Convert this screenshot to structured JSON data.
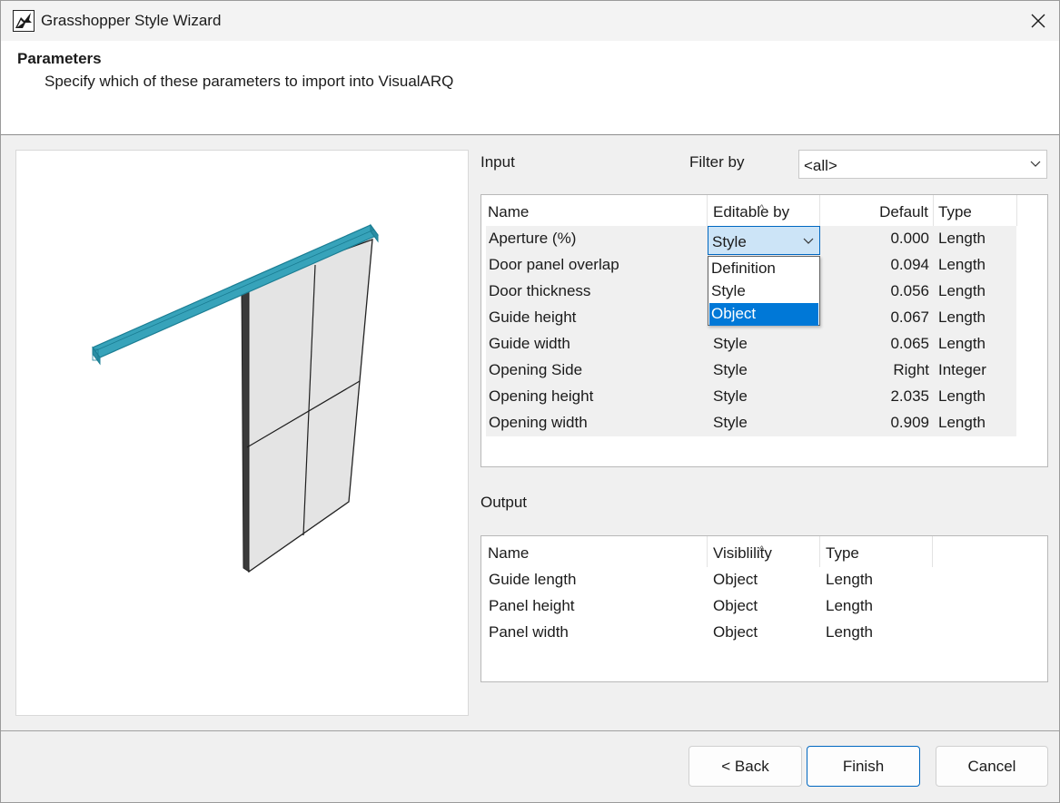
{
  "window": {
    "title": "Grasshopper Style Wizard"
  },
  "header": {
    "title": "Parameters",
    "subtitle": "Specify which of these parameters to import into VisualARQ"
  },
  "input": {
    "label": "Input",
    "filter_label": "Filter by",
    "filter_value": "<all>",
    "columns": [
      "Name",
      "Editable by",
      "Default",
      "Type"
    ],
    "rows": [
      {
        "name": "Aperture (%)",
        "editable": "Style",
        "default": "0.000",
        "type": "Length"
      },
      {
        "name": "Door panel overlap",
        "editable": "",
        "default": "0.094",
        "type": "Length"
      },
      {
        "name": "Door thickness",
        "editable": "",
        "default": "0.056",
        "type": "Length"
      },
      {
        "name": "Guide height",
        "editable": "",
        "default": "0.067",
        "type": "Length"
      },
      {
        "name": "Guide width",
        "editable": "Style",
        "default": "0.065",
        "type": "Length"
      },
      {
        "name": "Opening Side",
        "editable": "Style",
        "default": "Right",
        "type": "Integer"
      },
      {
        "name": "Opening height",
        "editable": "Style",
        "default": "2.035",
        "type": "Length"
      },
      {
        "name": "Opening width",
        "editable": "Style",
        "default": "0.909",
        "type": "Length"
      }
    ],
    "dropdown": {
      "value": "Style",
      "options": [
        "Definition",
        "Style",
        "Object"
      ],
      "highlighted": "Object"
    }
  },
  "output": {
    "label": "Output",
    "columns": [
      "Name",
      "Visiblility",
      "Type"
    ],
    "rows": [
      {
        "name": "Guide length",
        "visibility": "Object",
        "type": "Length"
      },
      {
        "name": "Panel height",
        "visibility": "Object",
        "type": "Length"
      },
      {
        "name": "Panel width",
        "visibility": "Object",
        "type": "Length"
      }
    ]
  },
  "buttons": {
    "back": "< Back",
    "finish": "Finish",
    "cancel": "Cancel"
  },
  "colors": {
    "accent": "#0078d7",
    "guide_rail": "#3aa6bd",
    "selection_bg": "#cce4f7"
  }
}
